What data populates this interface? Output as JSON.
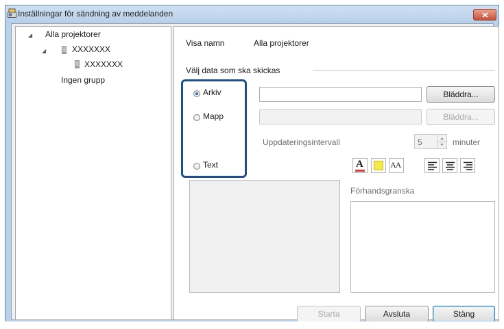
{
  "window": {
    "title": "Inställningar för sändning av meddelanden",
    "icon": "projector-settings-icon",
    "close_icon": "close-icon",
    "close_color": "#d2553c"
  },
  "tree": {
    "root_label": "Alla projektorer",
    "child_label": "XXXXXXX",
    "grandchild_label": "XXXXXXX",
    "no_group_label": "Ingen grupp"
  },
  "display_name": {
    "label": "Visa namn",
    "value": "Alla projektorer"
  },
  "data_select": {
    "legend": "Välj data som ska skickas",
    "options": [
      {
        "label": "Arkiv",
        "selected": true
      },
      {
        "label": "Mapp",
        "selected": false
      },
      {
        "label": "Text",
        "selected": false
      }
    ],
    "highlight_color": "#1e4f8c"
  },
  "arkiv": {
    "value": "",
    "browse_label": "Bläddra..."
  },
  "mapp": {
    "value": "",
    "browse_label": "Bläddra..."
  },
  "update_interval": {
    "label": "Uppdateringsintervall",
    "value": "5",
    "unit": "minuter"
  },
  "text_format": {
    "font_color_icon": "font-color-icon",
    "background_color_icon": "background-color-icon",
    "font_size_icon": "font-size-icon",
    "align_left_icon": "align-left-icon",
    "align_center_icon": "align-center-icon",
    "align_right_icon": "align-right-icon",
    "font_size_glyph": "AA",
    "font_color_glyph": "A",
    "font_color": "#d93a3a",
    "background_color": "#f4ea4a"
  },
  "preview": {
    "label": "Förhandsgranska"
  },
  "buttons": {
    "start": "Starta",
    "exit": "Avsluta",
    "close": "Stäng"
  }
}
